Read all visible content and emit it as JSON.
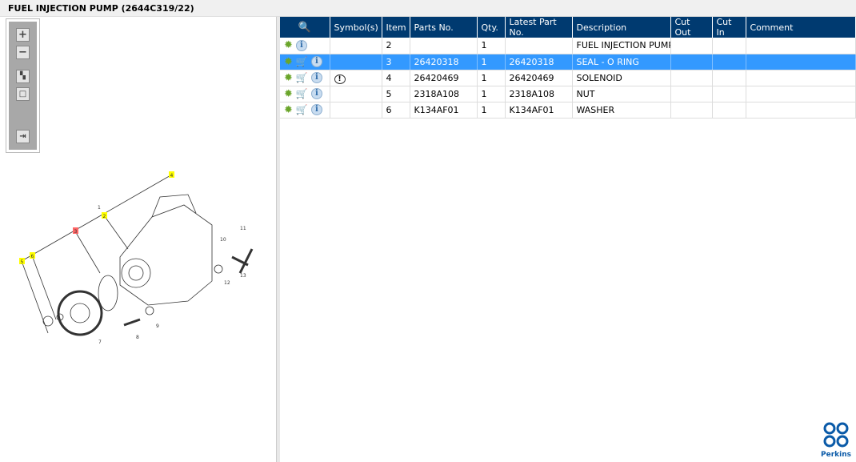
{
  "title": "FUEL INJECTION PUMP (2644C319/22)",
  "toolbar": {
    "zoom_in": "zoom-in",
    "zoom_out": "zoom-out",
    "fit": "fit",
    "actual": "actual",
    "export": "export"
  },
  "columns": [
    "",
    "Symbol(s)",
    "Item",
    "Parts No.",
    "Qty.",
    "Latest Part No.",
    "Description",
    "Cut Out",
    "Cut In",
    "Comment"
  ],
  "rows": [
    {
      "cart": false,
      "symbol": "",
      "item": "2",
      "parts_no": "",
      "qty": "1",
      "latest": "",
      "desc": "FUEL INJECTION PUMP",
      "selected": false
    },
    {
      "cart": true,
      "symbol": "",
      "item": "3",
      "parts_no": "26420318",
      "qty": "1",
      "latest": "26420318",
      "desc": "SEAL - O RING",
      "selected": true
    },
    {
      "cart": true,
      "symbol": "!",
      "item": "4",
      "parts_no": "26420469",
      "qty": "1",
      "latest": "26420469",
      "desc": "SOLENOID",
      "selected": false
    },
    {
      "cart": true,
      "symbol": "",
      "item": "5",
      "parts_no": "2318A108",
      "qty": "1",
      "latest": "2318A108",
      "desc": "NUT",
      "selected": false
    },
    {
      "cart": true,
      "symbol": "",
      "item": "6",
      "parts_no": "K134AF01",
      "qty": "1",
      "latest": "K134AF01",
      "desc": "WASHER",
      "selected": false
    }
  ],
  "diagram_labels": [
    "1",
    "2",
    "3",
    "4",
    "5",
    "6",
    "7",
    "8",
    "9",
    "10",
    "11",
    "12",
    "13"
  ],
  "logo": "Perkins",
  "colors": {
    "header": "#003a70",
    "selected": "#3399ff"
  }
}
